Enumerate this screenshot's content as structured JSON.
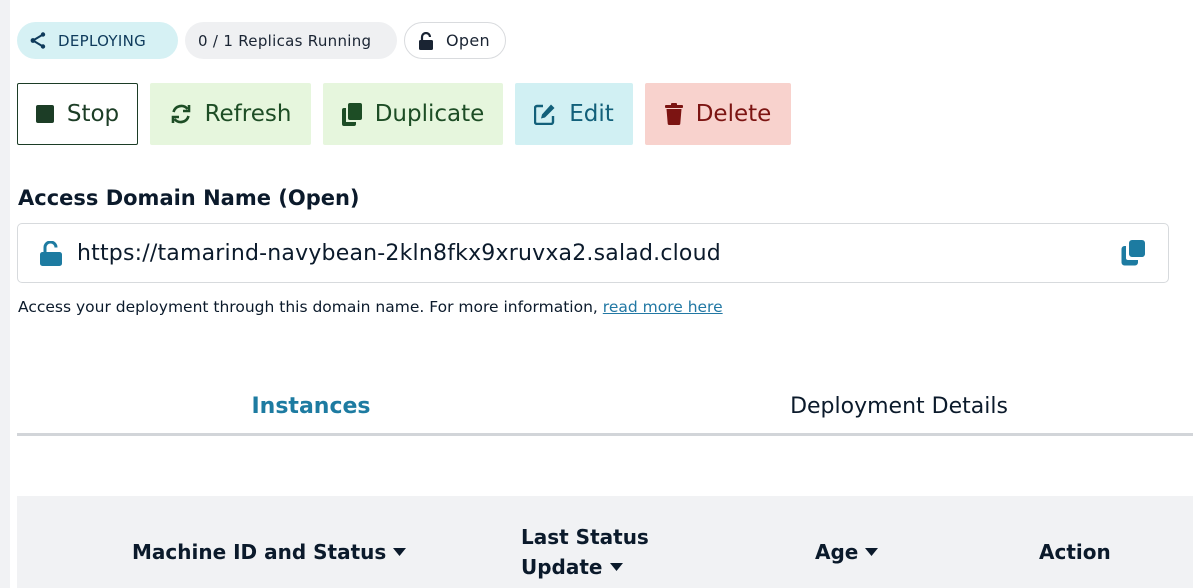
{
  "colors": {
    "accent_teal": "#1d7ba1",
    "deploying_bg": "#d6f1f4",
    "refresh_bg": "#e6f6dd",
    "edit_bg": "#d1f0f3",
    "delete_bg": "#f8d2cd",
    "text_dark": "#0b1a2b"
  },
  "badges": {
    "status": "DEPLOYING",
    "status_icon": "network-tree-icon",
    "replicas": "0 / 1 Replicas Running",
    "access": "Open",
    "access_icon": "unlocked-padlock-icon"
  },
  "toolbar": {
    "stop_label": "Stop",
    "refresh_label": "Refresh",
    "duplicate_label": "Duplicate",
    "edit_label": "Edit",
    "delete_label": "Delete"
  },
  "access_domain": {
    "label": "Access Domain Name (Open)",
    "url": "https://tamarind-navybean-2kln8fkx9xruvxa2.salad.cloud",
    "help_text": "Access your deployment through this domain name. For more information, ",
    "help_link": "read more here"
  },
  "tabs": [
    {
      "label": "Instances",
      "active": true
    },
    {
      "label": "Deployment Details",
      "active": false
    }
  ],
  "table": {
    "columns": [
      {
        "label": "Machine ID and Status",
        "sortable": true
      },
      {
        "label": "Last Status",
        "label_line2": "Update",
        "sortable": true
      },
      {
        "label": "Age",
        "sortable": true
      },
      {
        "label": "Action",
        "sortable": false
      }
    ]
  }
}
